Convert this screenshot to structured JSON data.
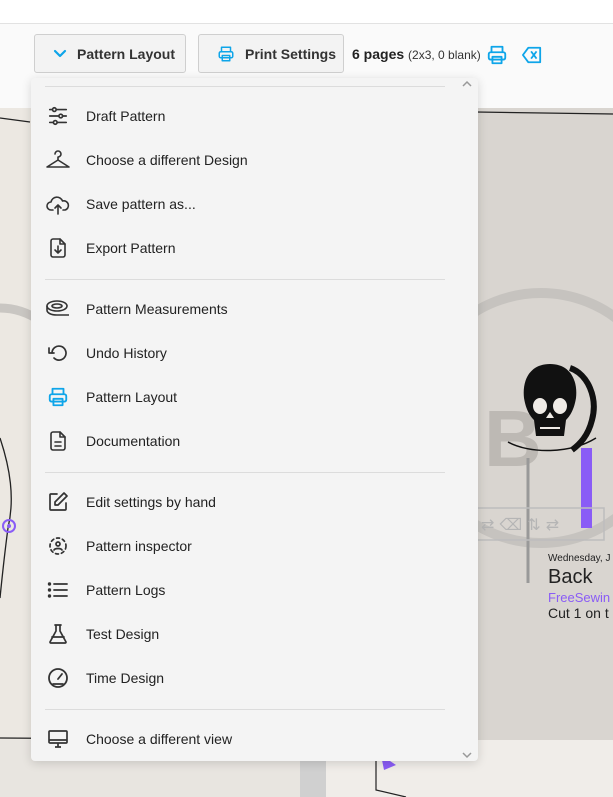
{
  "toolbar": {
    "layout_label": "Pattern Layout",
    "print_label": "Print Settings",
    "pages_count": "6 pages",
    "pages_detail": "(2x3, 0 blank)"
  },
  "canvas": {
    "pattern_piece": {
      "letter": "B",
      "date": "Wednesday, J",
      "name": "Back",
      "brand": "FreeSewin",
      "cut": "Cut 1 on t"
    }
  },
  "menu": {
    "groups": [
      [
        {
          "label": "Draft Pattern",
          "icon": "sliders-icon"
        },
        {
          "label": "Choose a different Design",
          "icon": "hanger-icon"
        },
        {
          "label": "Save pattern as...",
          "icon": "cloud-upload-icon"
        },
        {
          "label": "Export Pattern",
          "icon": "file-export-icon"
        }
      ],
      [
        {
          "label": "Pattern Measurements",
          "icon": "tape-measure-icon"
        },
        {
          "label": "Undo History",
          "icon": "undo-icon"
        },
        {
          "label": "Pattern Layout",
          "icon": "printer-icon",
          "active": true
        },
        {
          "label": "Documentation",
          "icon": "document-icon"
        }
      ],
      [
        {
          "label": "Edit settings by hand",
          "icon": "edit-icon"
        },
        {
          "label": "Pattern inspector",
          "icon": "inspector-icon"
        },
        {
          "label": "Pattern Logs",
          "icon": "list-icon"
        },
        {
          "label": "Test Design",
          "icon": "flask-icon"
        },
        {
          "label": "Time Design",
          "icon": "gauge-icon"
        }
      ],
      [
        {
          "label": "Choose a different view",
          "icon": "monitor-icon"
        }
      ]
    ]
  },
  "colors": {
    "accent": "#0ea5e9",
    "brand_purple": "#8a5cf6"
  }
}
